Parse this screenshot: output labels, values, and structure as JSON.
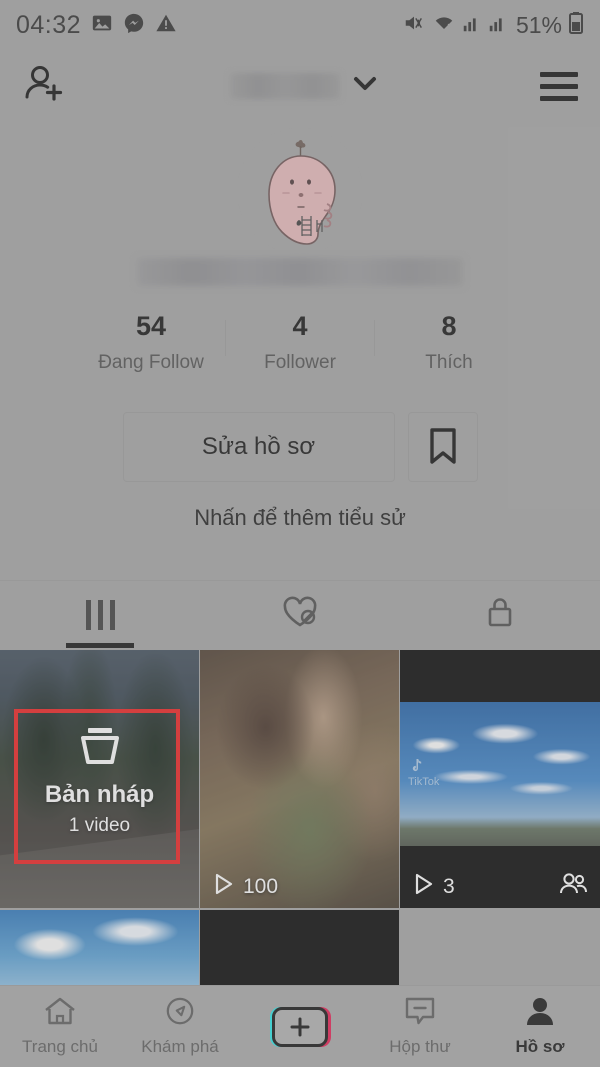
{
  "status_bar": {
    "time": "04:32",
    "battery_percent": "51%",
    "left_icons": [
      "photo-icon",
      "messenger-icon",
      "warning-icon"
    ],
    "right_icons": [
      "mute-vibrate-icon",
      "wifi-icon",
      "signal-bars-icon",
      "signal-bars-2-icon",
      "battery-icon"
    ]
  },
  "top_nav": {
    "add_friend_icon": "add-person-icon",
    "username": "",
    "username_redacted": true,
    "chevron": "chevron-down-icon",
    "menu_icon": "hamburger-menu-icon"
  },
  "profile": {
    "avatar_alt": "pink cartoon blob character",
    "handle": "",
    "handle_redacted": true,
    "bio_placeholder": "Nhấn để thêm tiểu sử",
    "stats": [
      {
        "value": "54",
        "label": "Đang Follow"
      },
      {
        "value": "4",
        "label": "Follower"
      },
      {
        "value": "8",
        "label": "Thích"
      }
    ],
    "edit_button": "Sửa hồ sơ",
    "bookmark_icon": "bookmark-icon"
  },
  "tabs": [
    {
      "name": "videos",
      "icon": "grid-bars-icon",
      "active": true
    },
    {
      "name": "liked-hidden",
      "icon": "heart-slash-icon",
      "active": false
    },
    {
      "name": "private",
      "icon": "lock-icon",
      "active": false
    }
  ],
  "grid": {
    "items": [
      {
        "type": "draft",
        "icon": "drafts-box-icon",
        "title": "Bản nháp",
        "subtitle": "1 video",
        "highlighted": true,
        "highlight_color": "#ef1a1a",
        "thumbnail_alt": "forest road with motorbikes"
      },
      {
        "type": "video",
        "views": "100",
        "play_icon": "play-icon",
        "thumbnail_alt": "portrait of woman, mirrored reflections"
      },
      {
        "type": "video",
        "views": "3",
        "play_icon": "play-icon",
        "privacy_icon": "friends-icon",
        "watermark": "TikTok",
        "thumbnail_alt": "blue sky with clouds over a town"
      },
      {
        "type": "video",
        "thumbnail_alt": "sky with clouds"
      },
      {
        "type": "video",
        "thumbnail_alt": "black frame"
      },
      {
        "type": "empty"
      }
    ]
  },
  "bottom_nav": {
    "items": [
      {
        "label": "Trang chủ",
        "icon": "home-icon",
        "active": false
      },
      {
        "label": "Khám phá",
        "icon": "compass-icon",
        "active": false
      },
      {
        "label": "",
        "icon": "create-plus-icon",
        "active": false
      },
      {
        "label": "Hộp thư",
        "icon": "inbox-message-icon",
        "active": false
      },
      {
        "label": "Hồ sơ",
        "icon": "person-icon",
        "active": true
      }
    ]
  },
  "colors": {
    "accent_cyan": "#25e8ea",
    "accent_pink": "#e8174e",
    "highlight_red": "#ef1a1a",
    "background": "#a4a4a4"
  }
}
